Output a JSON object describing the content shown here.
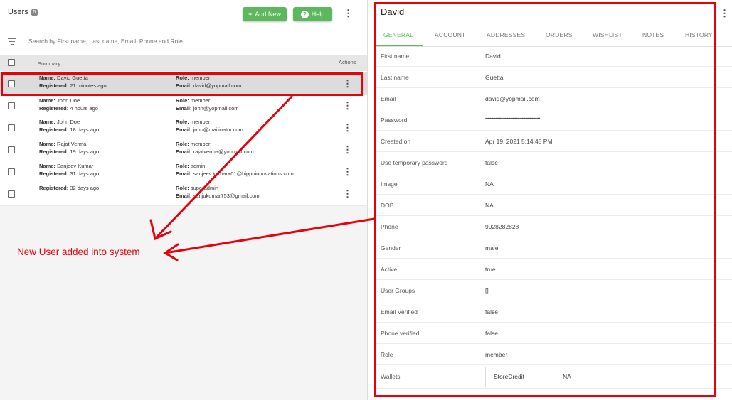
{
  "users_panel": {
    "title": "Users",
    "count": "6",
    "add_new_label": "Add New",
    "help_label": "Help",
    "search_placeholder": "Search by First name, Last name, Email, Phone and Role",
    "columns": {
      "summary": "Summary",
      "actions": "Actions"
    },
    "labels": {
      "name": "Name:",
      "registered": "Registered:",
      "role": "Role:",
      "email": "Email:"
    },
    "rows": [
      {
        "name": "David Guetta",
        "registered": "21 minutes ago",
        "role": "member",
        "email": "david@yopmail.com"
      },
      {
        "name": "John Doe",
        "registered": "4 hours ago",
        "role": "member",
        "email": "john@yopmail.com"
      },
      {
        "name": "John Doe",
        "registered": "18 days ago",
        "role": "member",
        "email": "john@mailinator.com"
      },
      {
        "name": "Rajat Verma",
        "registered": "19 days ago",
        "role": "member",
        "email": "rajatverma@yopmail.com"
      },
      {
        "name": "Sanjeev Kumar",
        "registered": "31 days ago",
        "role": "admin",
        "email": "sanjeev.kumar+01@hippoinnovations.com"
      },
      {
        "name": "",
        "registered": "32 days ago",
        "role": "superadmin",
        "email": "sanjukumar753@gmail.com"
      }
    ]
  },
  "detail_panel": {
    "title": "David",
    "tabs": [
      "GENERAL",
      "ACCOUNT",
      "ADDRESSES",
      "ORDERS",
      "WISHLIST",
      "NOTES",
      "HISTORY"
    ],
    "fields": [
      {
        "label": "First name",
        "value": "David"
      },
      {
        "label": "Last name",
        "value": "Guetta"
      },
      {
        "label": "Email",
        "value": "david@yopmail.com"
      },
      {
        "label": "Password",
        "value": "••••••••••••••••••••••••••••••••••••••••••••••••"
      },
      {
        "label": "Created on",
        "value": "Apr 19, 2021 5:14:48 PM"
      },
      {
        "label": "Use temporary password",
        "value": "false"
      },
      {
        "label": "Image",
        "value": "NA"
      },
      {
        "label": "DOB",
        "value": "NA"
      },
      {
        "label": "Phone",
        "value": "9928282828"
      },
      {
        "label": "Gender",
        "value": "male"
      },
      {
        "label": "Active",
        "value": "true"
      },
      {
        "label": "User Groups",
        "value": "[]"
      },
      {
        "label": "Email Verified",
        "value": "false"
      },
      {
        "label": "Phone verified",
        "value": "false"
      },
      {
        "label": "Role",
        "value": "member"
      }
    ],
    "wallets": {
      "label": "Wallets",
      "name": "StoreCredit",
      "value": "NA"
    }
  },
  "annotation": {
    "text": "New User added into system",
    "color": "#e8000b"
  },
  "colors": {
    "accent": "#5cb85c",
    "annotation": "#e8000b"
  }
}
